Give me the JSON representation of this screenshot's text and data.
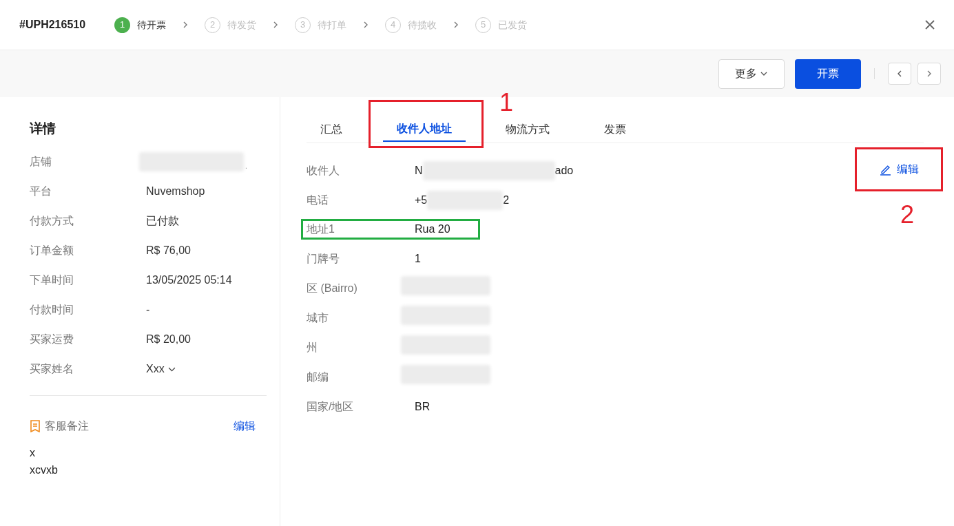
{
  "order_id": "#UPH216510",
  "steps": [
    {
      "number": "1",
      "label": "待开票",
      "selected": true
    },
    {
      "number": "2",
      "label": "待发货",
      "selected": false
    },
    {
      "number": "3",
      "label": "待打单",
      "selected": false
    },
    {
      "number": "4",
      "label": "待揽收",
      "selected": false
    },
    {
      "number": "5",
      "label": "已发货",
      "selected": false
    }
  ],
  "toolbar": {
    "more": "更多",
    "primary": "开票"
  },
  "details": {
    "title": "详情",
    "rows": [
      {
        "label": "店铺",
        "kind": "redacted",
        "value_end": "."
      },
      {
        "label": "平台",
        "kind": "text",
        "value": "Nuvemshop"
      },
      {
        "label": "付款方式",
        "kind": "text",
        "value": "已付款"
      },
      {
        "label": "订单金额",
        "kind": "text",
        "value": "R$ 76,00"
      },
      {
        "label": "下单时间",
        "kind": "text",
        "value": "13/05/2025 05:14"
      },
      {
        "label": "付款时间",
        "kind": "text",
        "value": "-"
      },
      {
        "label": "买家运费",
        "kind": "text",
        "value": "R$ 20,00"
      },
      {
        "label": "买家姓名",
        "kind": "dropdown",
        "value": "Xxx"
      }
    ]
  },
  "note": {
    "title": "客服备注",
    "edit": "编辑",
    "lines": [
      "x",
      "xcvxb"
    ]
  },
  "tabs": [
    {
      "label": "汇总",
      "selected": false
    },
    {
      "label": "收件人地址",
      "selected": true,
      "annotation": "1"
    },
    {
      "label": "物流方式",
      "selected": false
    },
    {
      "label": "发票",
      "selected": false
    }
  ],
  "address": {
    "edit": "编辑",
    "edit_annotation": "2",
    "rows": [
      {
        "label": "收件人",
        "kind": "partial",
        "value_start": "N",
        "value_end": "ado",
        "highlighted": false
      },
      {
        "label": "电话",
        "kind": "partial",
        "value_start": "+5",
        "value_end": "2",
        "highlighted": false
      },
      {
        "label": "地址1",
        "kind": "text",
        "value": "Rua 20",
        "highlighted": true
      },
      {
        "label": "门牌号",
        "kind": "text",
        "value": "1",
        "highlighted": false
      },
      {
        "label": "区 (Bairro)",
        "kind": "redacted",
        "highlighted": false
      },
      {
        "label": "城市",
        "kind": "redacted",
        "highlighted": false
      },
      {
        "label": "州",
        "kind": "redacted",
        "highlighted": false
      },
      {
        "label": "邮编",
        "kind": "redacted",
        "highlighted": false
      },
      {
        "label": "国家/地区",
        "kind": "text",
        "value": "BR",
        "highlighted": false
      }
    ]
  }
}
